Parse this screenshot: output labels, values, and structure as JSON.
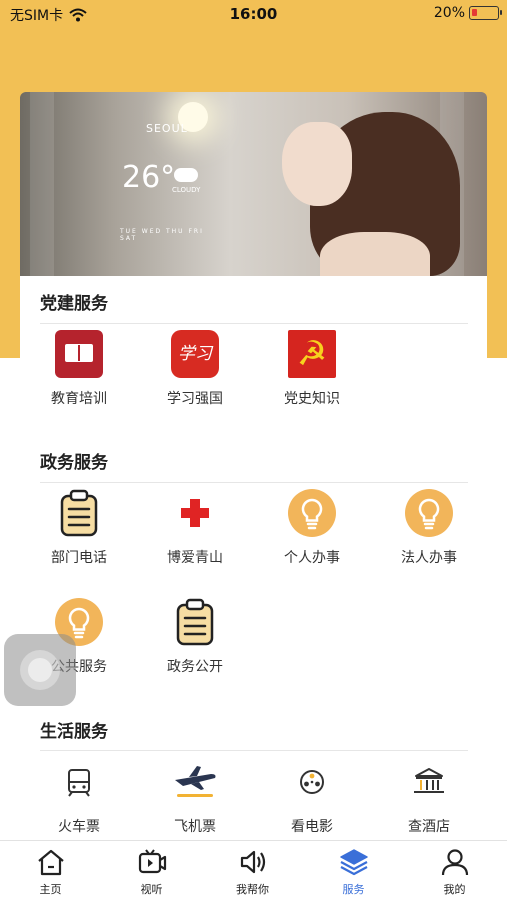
{
  "status_bar": {
    "carrier": "无SIM卡",
    "time": "16:00",
    "battery_percent_text": "20%",
    "battery_level": 0.2
  },
  "banner": {
    "weather_city": "SEOUL",
    "weather_temp": "26°",
    "weather_condition": "CLOUDY",
    "weather_days": "TUE WED THU FRI SAT"
  },
  "sections": {
    "party": {
      "title": "党建服务",
      "items": [
        {
          "label": "教育培训",
          "icon": "book-icon"
        },
        {
          "label": "学习强国",
          "icon": "xuexi-icon",
          "glyph": "学习"
        },
        {
          "label": "党史知识",
          "icon": "party-emblem-icon",
          "glyph": "☭"
        }
      ]
    },
    "government": {
      "title": "政务服务",
      "items": [
        {
          "label": "部门电话",
          "icon": "clipboard-icon"
        },
        {
          "label": "博爱青山",
          "icon": "red-cross-icon"
        },
        {
          "label": "个人办事",
          "icon": "lightbulb-icon"
        },
        {
          "label": "法人办事",
          "icon": "lightbulb-icon"
        },
        {
          "label": "公共服务",
          "icon": "lightbulb-icon"
        },
        {
          "label": "政务公开",
          "icon": "clipboard-icon"
        }
      ]
    },
    "life": {
      "title": "生活服务",
      "items": [
        {
          "label": "火车票",
          "icon": "train-icon"
        },
        {
          "label": "飞机票",
          "icon": "airplane-icon"
        },
        {
          "label": "看电影",
          "icon": "film-reel-icon"
        },
        {
          "label": "查酒店",
          "icon": "hotel-icon"
        }
      ]
    }
  },
  "tabbar": {
    "active": "服务",
    "items": [
      {
        "label": "主页",
        "icon": "home-icon"
      },
      {
        "label": "视听",
        "icon": "tv-icon"
      },
      {
        "label": "我帮你",
        "icon": "speaker-icon"
      },
      {
        "label": "服务",
        "icon": "layers-icon"
      },
      {
        "label": "我的",
        "icon": "user-icon"
      }
    ]
  },
  "colors": {
    "header_yellow": "#F2C055",
    "accent_blue": "#3A6FD8",
    "icon_orange": "#F2B55A",
    "party_red": "#D5251F"
  }
}
